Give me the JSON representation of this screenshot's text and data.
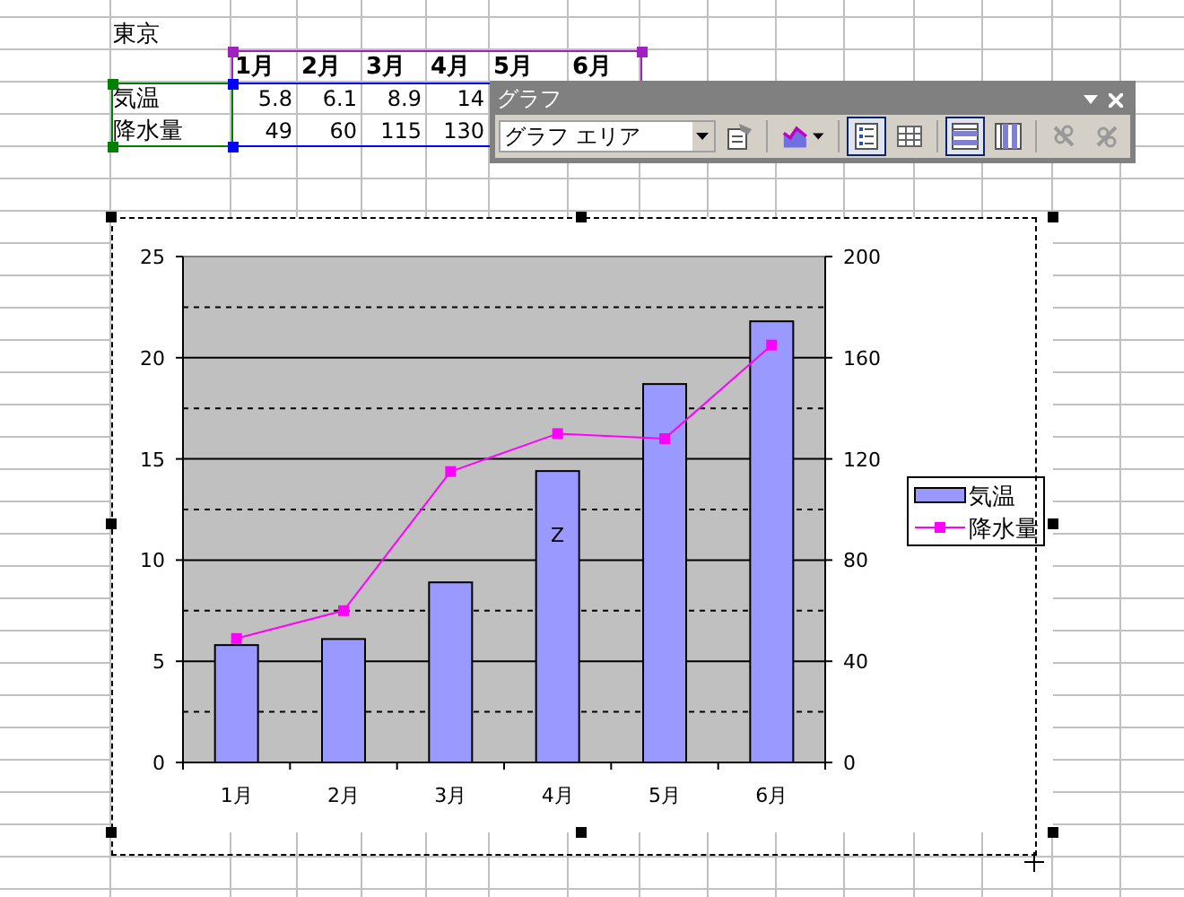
{
  "sheet": {
    "title_cell": "東京",
    "header_row": [
      "1月",
      "2月",
      "3月",
      "4月",
      "5月",
      "6月"
    ],
    "rows": [
      {
        "label": "気温",
        "values": [
          "5.8",
          "6.1",
          "8.9",
          "14"
        ]
      },
      {
        "label": "降水量",
        "values": [
          "49",
          "60",
          "115",
          "130"
        ]
      }
    ]
  },
  "toolbar": {
    "title": "グラフ",
    "dropdown": {
      "value": "グラフ エリア"
    },
    "buttons": [
      {
        "kind": "properties",
        "pressed": false
      },
      {
        "kind": "chart-type",
        "pressed": false
      },
      {
        "kind": "legend",
        "pressed": true
      },
      {
        "kind": "data-table",
        "pressed": false
      },
      {
        "kind": "by-row",
        "pressed": true
      },
      {
        "kind": "by-column",
        "pressed": false
      },
      {
        "kind": "angle-down",
        "pressed": false
      },
      {
        "kind": "angle-up",
        "pressed": false
      }
    ]
  },
  "chart": {
    "chart_data": {
      "type": "bar",
      "categories": [
        "1月",
        "2月",
        "3月",
        "4月",
        "5月",
        "6月"
      ],
      "series": [
        {
          "name": "気温",
          "color": "#9999ff",
          "type": "bar",
          "values": [
            5.8,
            6.1,
            8.9,
            14.4,
            18.7,
            21.8
          ]
        },
        {
          "name": "降水量",
          "color": "#ff00ff",
          "type": "line",
          "axis": "y2",
          "marker": "square",
          "values": [
            49,
            60,
            115,
            130,
            128,
            165
          ]
        }
      ],
      "ylim": [
        0,
        25
      ],
      "yticks": [
        0,
        5,
        10,
        15,
        20,
        25
      ],
      "y2lim": [
        0,
        200
      ],
      "y2ticks": [
        0,
        40,
        80,
        120,
        160,
        200
      ],
      "grid": true,
      "legend": true,
      "annotations": [
        "Z"
      ]
    }
  }
}
